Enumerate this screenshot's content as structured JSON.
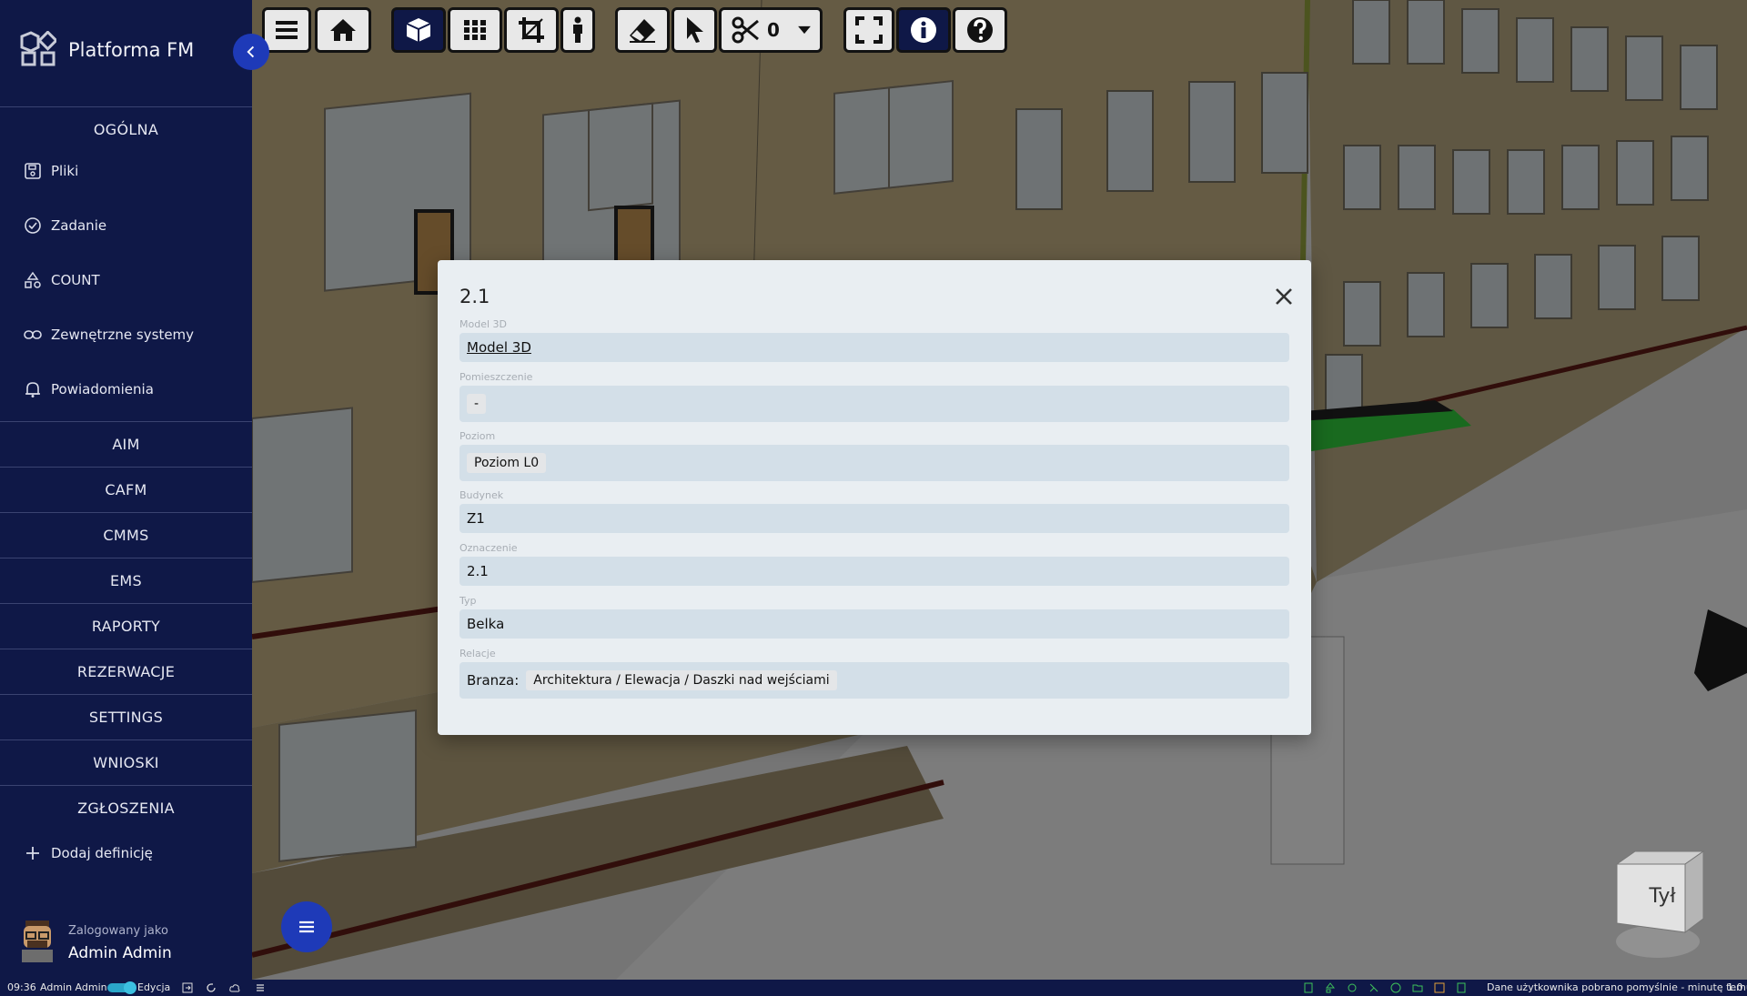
{
  "app": {
    "title": "Platforma FM"
  },
  "sidebar": {
    "collapse_icon": "chevron-left-icon",
    "sections_top": "OGÓLNA",
    "sub_items": [
      {
        "label": "Pliki",
        "icon": "save-icon"
      },
      {
        "label": "Zadanie",
        "icon": "check-circle-icon"
      },
      {
        "label": "COUNT",
        "icon": "shapes-icon"
      },
      {
        "label": "Zewnętrzne systemy",
        "icon": "link-icon"
      },
      {
        "label": "Powiadomienia",
        "icon": "bell-icon"
      }
    ],
    "sections": [
      "AIM",
      "CAFM",
      "CMMS",
      "EMS",
      "RAPORTY",
      "REZERWACJE",
      "SETTINGS",
      "WNIOSKI",
      "ZGŁOSZENIA"
    ],
    "add_definition": "Dodaj definicję",
    "user": {
      "label": "Zalogowany jako",
      "name": "Admin Admin"
    }
  },
  "toolbar": {
    "buttons": [
      "menu-icon",
      "home-icon",
      "cube-icon",
      "grid-icon",
      "crop-icon",
      "person-icon",
      "eraser-icon",
      "pointer-icon",
      "scissors-icon",
      "fullscreen-icon",
      "info-icon",
      "help-icon"
    ],
    "scissors_count": "0"
  },
  "modal": {
    "title": "2.1",
    "fields": {
      "model": {
        "label": "Model 3D",
        "value": "Model 3D"
      },
      "room": {
        "label": "Pomieszczenie",
        "value": "-"
      },
      "level": {
        "label": "Poziom",
        "value": "Poziom L0"
      },
      "building": {
        "label": "Budynek",
        "value": "Z1"
      },
      "mark": {
        "label": "Oznaczenie",
        "value": "2.1"
      },
      "type": {
        "label": "Typ",
        "value": "Belka"
      },
      "relations": {
        "label": "Relacje",
        "key": "Branza:",
        "value": "Architektura / Elewacja / Daszki nad wejściami"
      }
    }
  },
  "viewcube": {
    "face_label": "Tył"
  },
  "statusbar": {
    "time": "09:36",
    "user": "Admin Admin",
    "mode": "Edycja",
    "message": "Dane użytkownika pobrano pomyślnie - minutę temu",
    "version": "1.0"
  },
  "colors": {
    "sidebar": "#0f1847",
    "accent": "#1e3ab8",
    "modal_bg": "#e9eef2",
    "field_bg": "#d3dfe8"
  }
}
